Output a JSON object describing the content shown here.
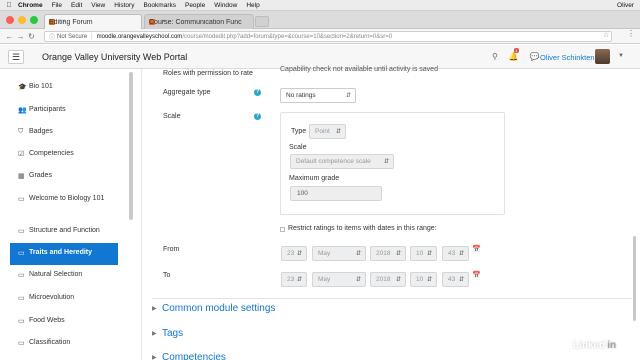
{
  "menubar": {
    "items": [
      "Chrome",
      "File",
      "Edit",
      "View",
      "History",
      "Bookmarks",
      "People",
      "Window",
      "Help"
    ],
    "user": "Oliver"
  },
  "tabs": [
    {
      "label": "Editing Forum",
      "close": "×"
    },
    {
      "label": "Course: Communication Func",
      "close": "×"
    }
  ],
  "browser": {
    "security": "Not Secure",
    "url_host": "moodle.orangevalleyschool.com",
    "url_path": "/course/modedit.php?add=forum&type=&course=10&section=2&return=0&sr=0"
  },
  "navbar": {
    "site_name": "Orange Valley University Web Portal",
    "notification_count": "1",
    "user_name": "Oliver Schinkten"
  },
  "sidebar": {
    "items": [
      {
        "label": "Bio 101",
        "icon": "graduation-cap-icon",
        "glyph": "🎓",
        "active": false
      },
      {
        "label": "Participants",
        "icon": "users-icon",
        "glyph": "👥",
        "active": false
      },
      {
        "label": "Badges",
        "icon": "shield-icon",
        "glyph": "⛉",
        "active": false
      },
      {
        "label": "Competencies",
        "icon": "check-square-icon",
        "glyph": "☑",
        "active": false
      },
      {
        "label": "Grades",
        "icon": "table-icon",
        "glyph": "▦",
        "active": false
      },
      {
        "label": "Welcome to Biology 101",
        "icon": "folder-icon",
        "glyph": "▭",
        "active": false
      },
      {
        "label": "Structure and Function",
        "icon": "folder-icon",
        "glyph": "▭",
        "active": false
      },
      {
        "label": "Traits and Heredity",
        "icon": "folder-icon",
        "glyph": "▭",
        "active": true
      },
      {
        "label": "Natural Selection",
        "icon": "folder-icon",
        "glyph": "▭",
        "active": false
      },
      {
        "label": "Microevolution",
        "icon": "folder-icon",
        "glyph": "▭",
        "active": false
      },
      {
        "label": "Food Webs",
        "icon": "folder-icon",
        "glyph": "▭",
        "active": false
      },
      {
        "label": "Classification",
        "icon": "folder-icon",
        "glyph": "▭",
        "active": false
      }
    ]
  },
  "form": {
    "roles_label": "Roles with permission to rate",
    "roles_value": "Capability check not available until activity is saved",
    "aggregate_label": "Aggregate type",
    "aggregate_value": "No ratings",
    "scale_label": "Scale",
    "type_label": "Type",
    "type_value": "Point",
    "scale_sub_label": "Scale",
    "scale_value": "Default competence scale",
    "max_grade_label": "Maximum grade",
    "max_grade_value": "100",
    "restrict_label": "Restrict ratings to items with dates in this range:",
    "from_label": "From",
    "to_label": "To",
    "from": {
      "day": "23",
      "month": "May",
      "year": "2018",
      "hour": "10",
      "minute": "43"
    },
    "to": {
      "day": "23",
      "month": "May",
      "year": "2018",
      "hour": "10",
      "minute": "43"
    }
  },
  "sections": [
    "Common module settings",
    "Tags",
    "Competencies"
  ],
  "watermark": {
    "text": "Linked",
    "suffix": "in"
  },
  "colors": {
    "accent": "#1177d1",
    "help": "#2aa7c7"
  }
}
